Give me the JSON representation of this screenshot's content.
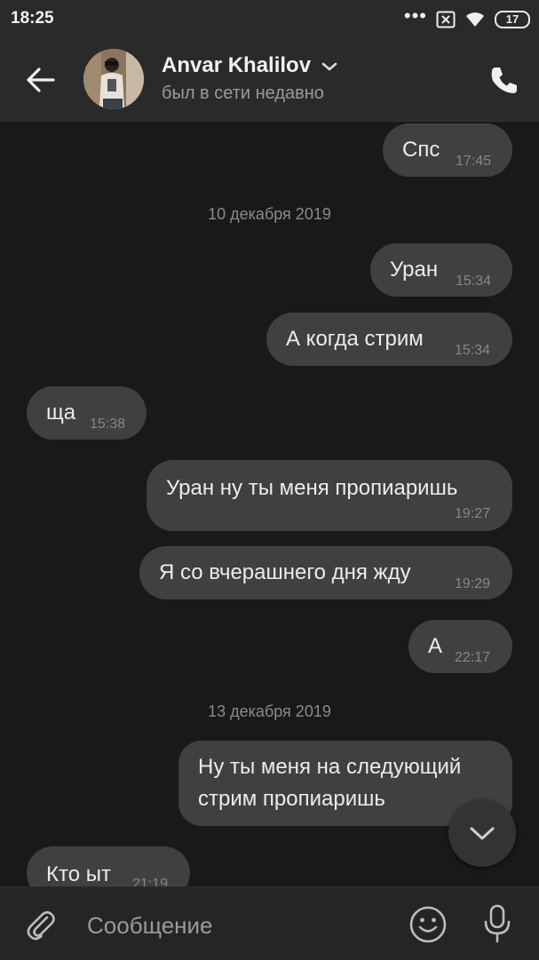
{
  "status_bar": {
    "time": "18:25",
    "battery": "17",
    "icons": [
      "dots-icon",
      "sim-icon",
      "wifi-icon",
      "battery-icon"
    ]
  },
  "header": {
    "contact_name": "Anvar Khalilov",
    "contact_status": "был в сети недавно"
  },
  "chat": {
    "messages": [
      {
        "side": "out",
        "text": "Спс",
        "time": "17:45"
      },
      {
        "side": "date",
        "text": "10 декабря 2019"
      },
      {
        "side": "out",
        "text": "Уран",
        "time": "15:34"
      },
      {
        "side": "out",
        "text": "А когда стрим",
        "time": "15:34"
      },
      {
        "side": "in",
        "text": "ща",
        "time": "15:38"
      },
      {
        "side": "out",
        "text": "Уран ну ты меня пропиаришь",
        "time": "19:27"
      },
      {
        "side": "out",
        "text": "Я со вчерашнего дня жду",
        "time": "19:29"
      },
      {
        "side": "out",
        "text": "А",
        "time": "22:17"
      },
      {
        "side": "date",
        "text": "13 декабря 2019"
      },
      {
        "side": "out",
        "text_line1": "Ну ты меня на следующий",
        "text_line2": "стрим пропиаришь"
      },
      {
        "side": "in",
        "text": "Кто ыт",
        "time": "21:19"
      }
    ]
  },
  "input_bar": {
    "placeholder": "Сообщение"
  },
  "colors": {
    "background": "#191919",
    "bar": "#2a2a2a",
    "bubble": "#404040",
    "time_text": "#868686"
  }
}
